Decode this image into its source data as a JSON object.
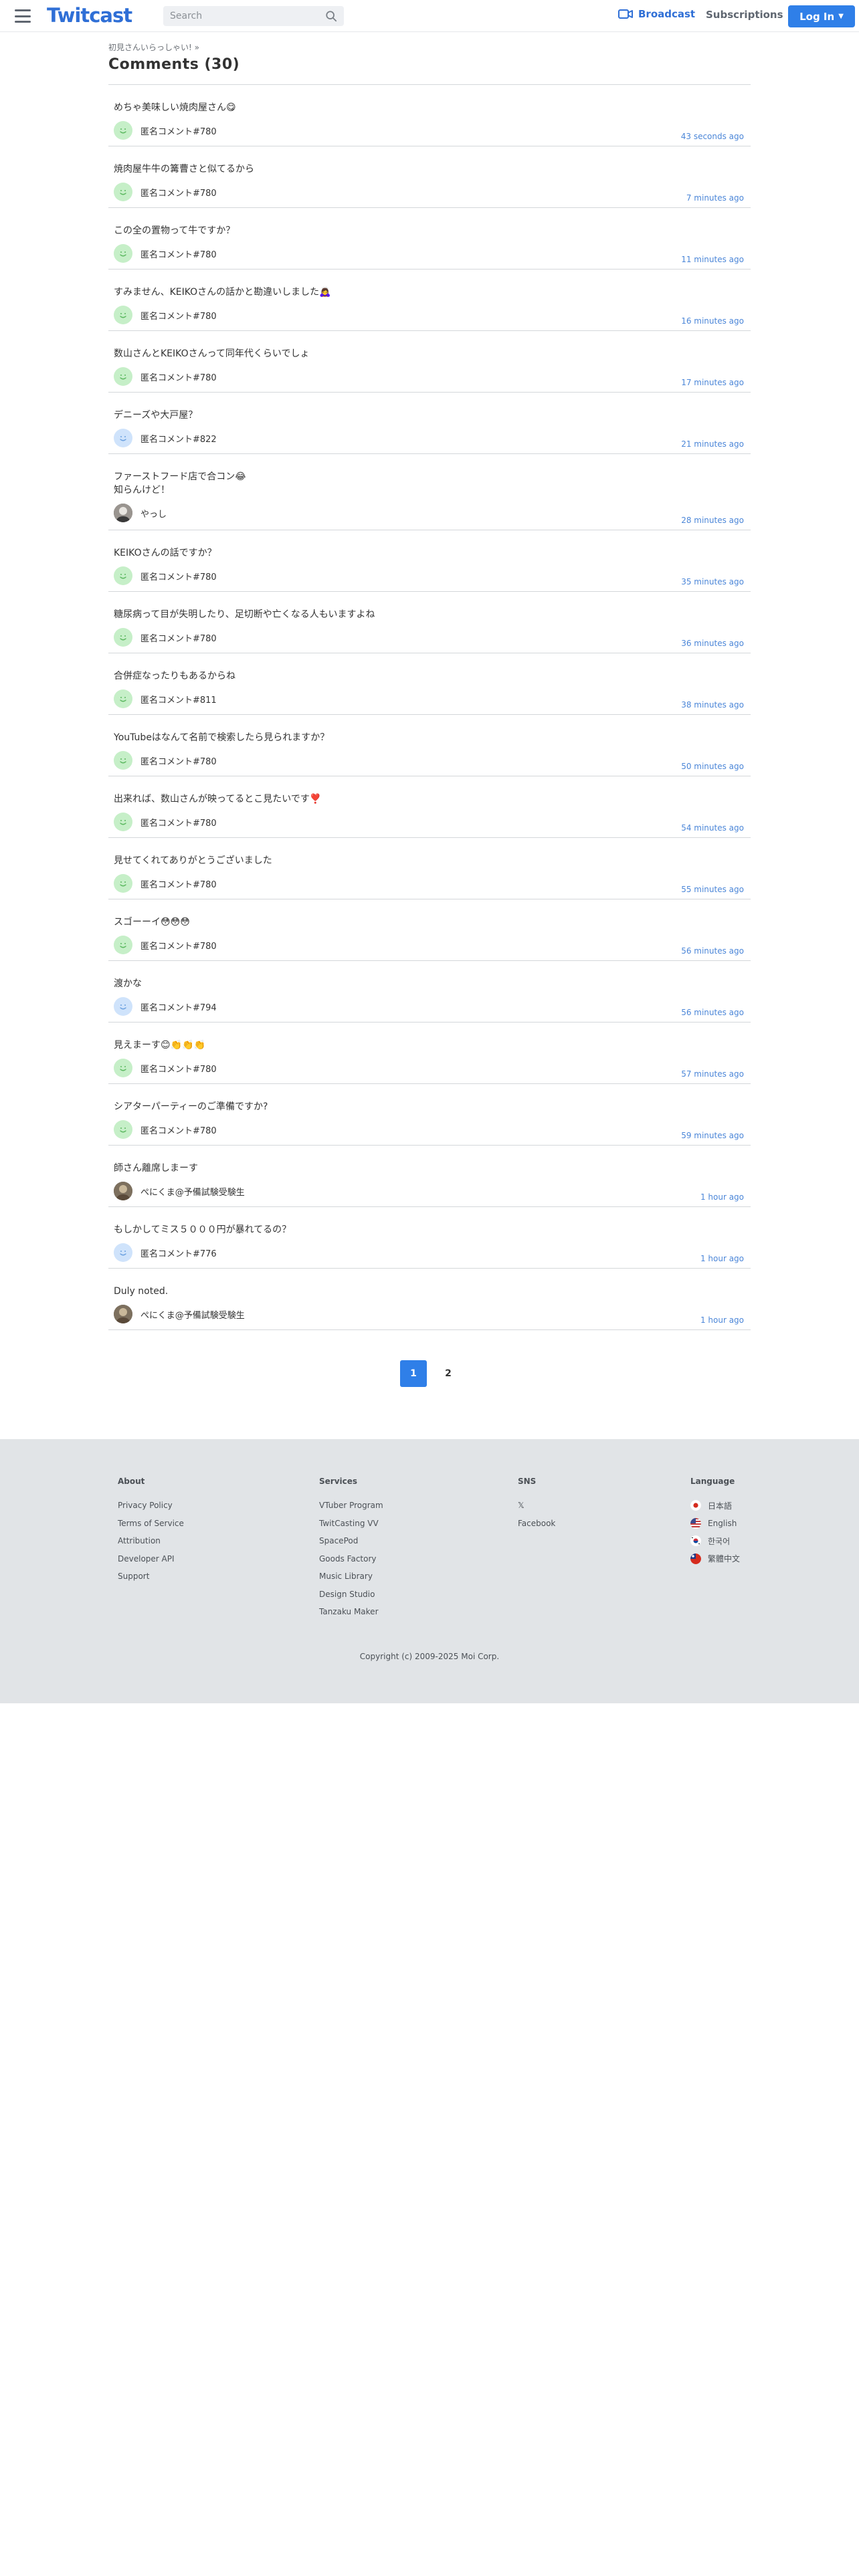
{
  "header": {
    "logo": "Twitcast",
    "search_placeholder": "Search",
    "broadcast_label": "Broadcast",
    "subscriptions_label": "Subscriptions",
    "login_label": "Log In"
  },
  "breadcrumb": "初見さんいらっしゃい! »",
  "page_title": "Comments (30)",
  "comments": [
    {
      "text": "めちゃ美味しい焼肉屋さん😋",
      "author": "匿名コメント#780",
      "time": "43 seconds ago",
      "avatar": "green"
    },
    {
      "text": "焼肉屋牛牛の篝曹さと似てるから",
      "author": "匿名コメント#780",
      "time": "7 minutes ago",
      "avatar": "green"
    },
    {
      "text": "この全の置物って牛ですか？",
      "author": "匿名コメント#780",
      "time": "11 minutes ago",
      "avatar": "green"
    },
    {
      "text": "すみません、KEIKOさんの話かと勘違いしました🙇‍♀️",
      "author": "匿名コメント#780",
      "time": "16 minutes ago",
      "avatar": "green"
    },
    {
      "text": "数山さんとKEIKOさんって同年代くらいでしょ",
      "author": "匿名コメント#780",
      "time": "17 minutes ago",
      "avatar": "green"
    },
    {
      "text": "デニーズや大戸屋？",
      "author": "匿名コメント#822",
      "time": "21 minutes ago",
      "avatar": "blue"
    },
    {
      "text": "ファーストフード店で合コン😂\n知らんけど！",
      "author": "やっし",
      "time": "28 minutes ago",
      "avatar": "photo"
    },
    {
      "text": "KEIKOさんの話ですか？",
      "author": "匿名コメント#780",
      "time": "35 minutes ago",
      "avatar": "green"
    },
    {
      "text": "糖尿病って目が失明したり、足切断や亡くなる人もいますよね",
      "author": "匿名コメント#780",
      "time": "36 minutes ago",
      "avatar": "green"
    },
    {
      "text": "合併症なったりもあるからね",
      "author": "匿名コメント#811",
      "time": "38 minutes ago",
      "avatar": "green"
    },
    {
      "text": "YouTubeはなんて名前で検索したら見られますか？",
      "author": "匿名コメント#780",
      "time": "50 minutes ago",
      "avatar": "green"
    },
    {
      "text": "出来れば、数山さんが映ってるとこ見たいです❣️",
      "author": "匿名コメント#780",
      "time": "54 minutes ago",
      "avatar": "green"
    },
    {
      "text": "見せてくれてありがとうございました",
      "author": "匿名コメント#780",
      "time": "55 minutes ago",
      "avatar": "green"
    },
    {
      "text": "スゴーーイ😳😳😳",
      "author": "匿名コメント#780",
      "time": "56 minutes ago",
      "avatar": "green"
    },
    {
      "text": "渡かな",
      "author": "匿名コメント#794",
      "time": "56 minutes ago",
      "avatar": "blue"
    },
    {
      "text": "見えまーす😊👏👏👏",
      "author": "匿名コメント#780",
      "time": "57 minutes ago",
      "avatar": "green"
    },
    {
      "text": "シアターパーティーのご準備ですか?",
      "author": "匿名コメント#780",
      "time": "59 minutes ago",
      "avatar": "green"
    },
    {
      "text": "師さん離席しまーす",
      "author": "ぺにくま@予備試験受験生",
      "time": "1 hour ago",
      "avatar": "photo2"
    },
    {
      "text": "もしかしてミス５０００円が暴れてるの？",
      "author": "匿名コメント#776",
      "time": "1 hour ago",
      "avatar": "blue"
    },
    {
      "text": "Duly noted.",
      "author": "ぺにくま@予備試験受験生",
      "time": "1 hour ago",
      "avatar": "photo2"
    }
  ],
  "pagination": {
    "pages": [
      "1",
      "2"
    ],
    "current": "1"
  },
  "footer": {
    "about": {
      "title": "About",
      "links": [
        "Privacy Policy",
        "Terms of Service",
        "Attribution",
        "Developer API",
        "Support"
      ]
    },
    "services": {
      "title": "Services",
      "links": [
        "VTuber Program",
        "TwitCasting VV",
        "SpacePod",
        "Goods Factory",
        "Music Library",
        "Design Studio",
        "Tanzaku Maker"
      ]
    },
    "sns": {
      "title": "SNS",
      "links": [
        "𝕏",
        "Facebook"
      ]
    },
    "language": {
      "title": "Language",
      "links": [
        "日本語",
        "English",
        "한국어",
        "繁體中文"
      ]
    },
    "copyright": "Copyright (c) 2009-2025 Moi Corp."
  },
  "colors": {
    "brand": "#2f6fd6",
    "button": "#2f7fe8",
    "timestamp": "#4b86d8",
    "footer_bg": "#e1e4e7"
  }
}
